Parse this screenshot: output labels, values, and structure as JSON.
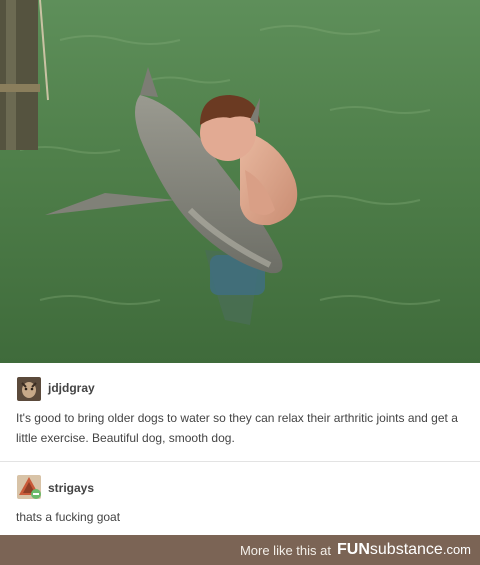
{
  "post1": {
    "username": "jdjdgray",
    "text": "It's good to bring older dogs to water so they can relax their arthritic joints and get a little exercise. Beautiful dog, smooth dog."
  },
  "post2": {
    "username": "strigays",
    "text": "thats a fucking goat"
  },
  "footer": {
    "more_label": "More like this at",
    "brand_fun": "FUN",
    "brand_substance": "substance",
    "brand_domain": ".com"
  }
}
